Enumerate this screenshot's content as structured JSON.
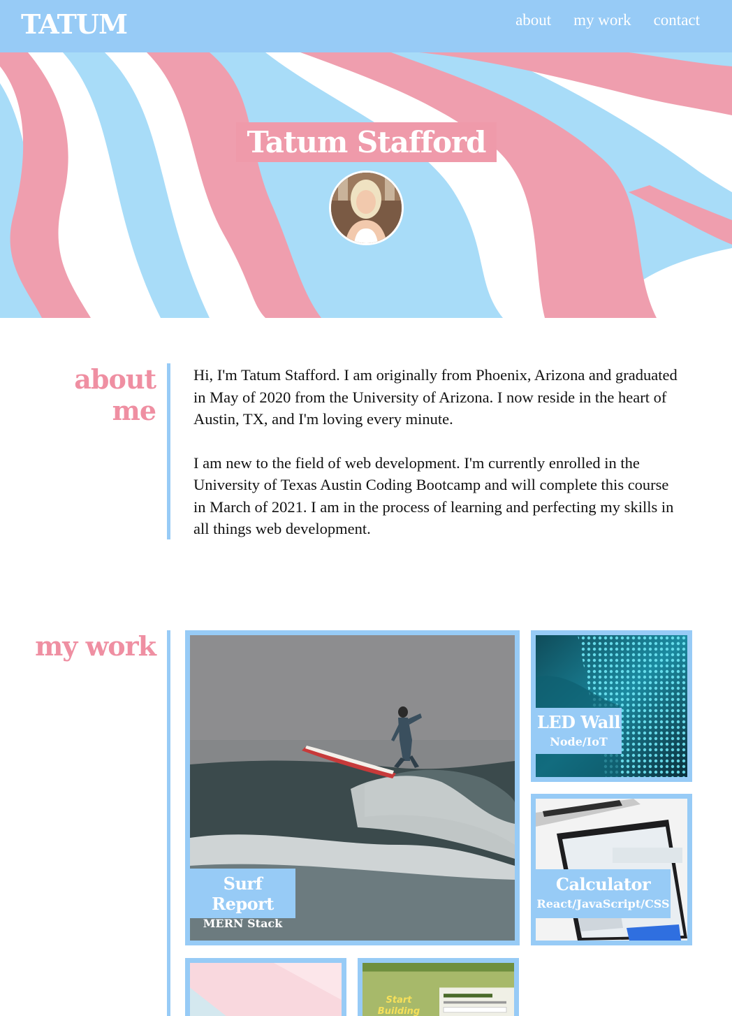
{
  "nav": {
    "brand": "TATUM",
    "links": [
      "about",
      "my work",
      "contact"
    ]
  },
  "hero": {
    "name": "Tatum Stafford"
  },
  "about": {
    "title_line1": "about",
    "title_line2": "me",
    "paragraph1": "Hi, I'm Tatum Stafford. I am originally from Phoenix, Arizona and graduated in May of 2020 from the University of Arizona. I now reside in the heart of Austin, TX, and I'm loving every minute.",
    "paragraph2": "I am new to the field of web development. I'm currently enrolled in the University of Texas Austin Coding Bootcamp and will complete this course in March of 2021. I am in the process of learning and perfecting my skills in all things web development."
  },
  "work": {
    "title": "my work",
    "projects": [
      {
        "title": "Surf Report",
        "stack": "MERN Stack"
      },
      {
        "title": "LED Wall",
        "stack": "Node/IoT"
      },
      {
        "title": "Calculator",
        "stack": "React/JavaScript/CSS"
      }
    ],
    "partial_card_text": "Start Building Habits."
  },
  "colors": {
    "accent_blue": "#97cbf6",
    "accent_pink": "#ef9aaa"
  }
}
